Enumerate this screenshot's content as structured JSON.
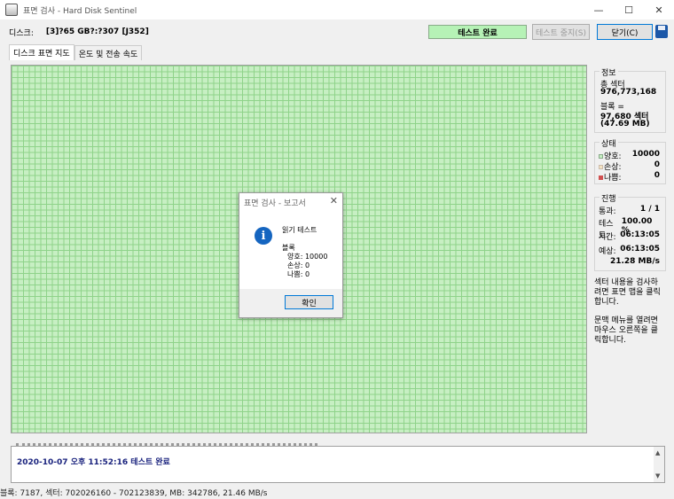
{
  "window": {
    "title": "표면 검사 - Hard Disk Sentinel",
    "minimize": "—",
    "maximize": "☐",
    "close": "✕"
  },
  "toolbar": {
    "disk_label": "디스크:",
    "disk_value": "[3]?65 GB?:?307 [J352]",
    "status": "테스트 완료",
    "stop_button": "테스트 중지(S)",
    "close_button": "닫기(C)"
  },
  "tabs": [
    {
      "label": "디스크 표면 지도",
      "active": true
    },
    {
      "label": "온도 및 전송 속도",
      "active": false
    }
  ],
  "map": {
    "color": "#c7efc3",
    "grid_color": "#8fd38a"
  },
  "sidebar": {
    "info": {
      "title": "정보",
      "sectors_label": "총 섹터",
      "sectors_value": "976,773,168",
      "block_label": "블록 =",
      "block_sectors": "97,680 섹터",
      "block_size": "(47.69 MB)"
    },
    "state": {
      "title": "상태",
      "good_label": "양호:",
      "good_value": "10000",
      "damaged_label": "손상:",
      "damaged_value": "0",
      "bad_label": "나쁨:",
      "bad_value": "0"
    },
    "progress": {
      "title": "진행",
      "pass_label": "통과:",
      "pass_value": "1 / 1",
      "test_label": "테스트:",
      "test_value": "100.00 %",
      "time_label": "시간:",
      "time_value": "06:13:05",
      "estimate_label": "예상:",
      "estimate_value": "06:13:05",
      "speed": "21.28 MB/s"
    },
    "hint1": [
      "섹터 내용을 검사하",
      "려면 표면 맵을 클릭",
      "합니다."
    ],
    "hint2": [
      "문맥 메뉴를 열려면",
      "마우스 오른쪽을 클",
      "릭합니다."
    ]
  },
  "log": {
    "line": "2020-10-07 오후 11:52:16  테스트 완료",
    "scroll_up": "▲",
    "scroll_down": "▼"
  },
  "statusbar": {
    "text": "블록: 7187, 섹터: 702026160 - 702123839, MB: 342786, 21.46 MB/s"
  },
  "dialog": {
    "title": "표면 검사 - 보고서",
    "close": "✕",
    "icon": "i",
    "heading": "읽기 테스트",
    "block_label": "블록",
    "good": "양호: 10000",
    "damaged": "손상: 0",
    "bad": "나쁨: 0",
    "ok_button": "확인"
  }
}
